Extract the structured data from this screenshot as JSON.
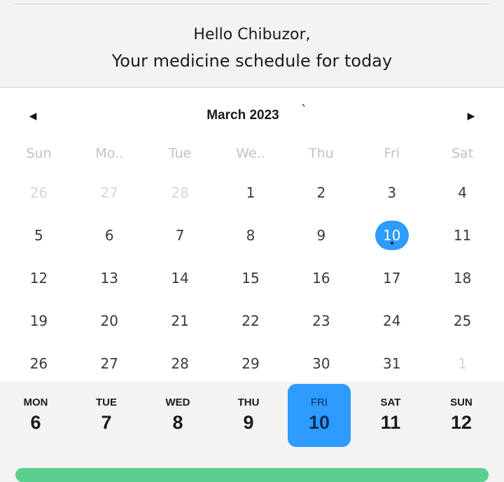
{
  "header": {
    "greeting": "Hello Chibuzor,",
    "subtitle": "Your medicine schedule for today"
  },
  "calendar": {
    "month_label": "March 2023",
    "stray_mark": "`",
    "weekday_headers": [
      "Sun",
      "Mo..",
      "Tue",
      "We..",
      "Thu",
      "Fri",
      "Sat"
    ],
    "weeks": [
      [
        "26",
        "27",
        "28",
        "1",
        "2",
        "3",
        "4"
      ],
      [
        "5",
        "6",
        "7",
        "8",
        "9",
        "10",
        "11"
      ],
      [
        "12",
        "13",
        "14",
        "15",
        "16",
        "17",
        "18"
      ],
      [
        "19",
        "20",
        "21",
        "22",
        "23",
        "24",
        "25"
      ],
      [
        "26",
        "27",
        "28",
        "29",
        "30",
        "31",
        "1"
      ]
    ],
    "selected_day": "10",
    "accent_color": "#2e9bff"
  },
  "week_strip": {
    "days": [
      {
        "weekday": "MON",
        "date": "6"
      },
      {
        "weekday": "TUE",
        "date": "7"
      },
      {
        "weekday": "WED",
        "date": "8"
      },
      {
        "weekday": "THU",
        "date": "9"
      },
      {
        "weekday": "FRI",
        "date": "10"
      },
      {
        "weekday": "SAT",
        "date": "11"
      },
      {
        "weekday": "SUN",
        "date": "12"
      }
    ],
    "active_weekday": "FRI"
  },
  "bottom_button_color": "#5ccf90"
}
